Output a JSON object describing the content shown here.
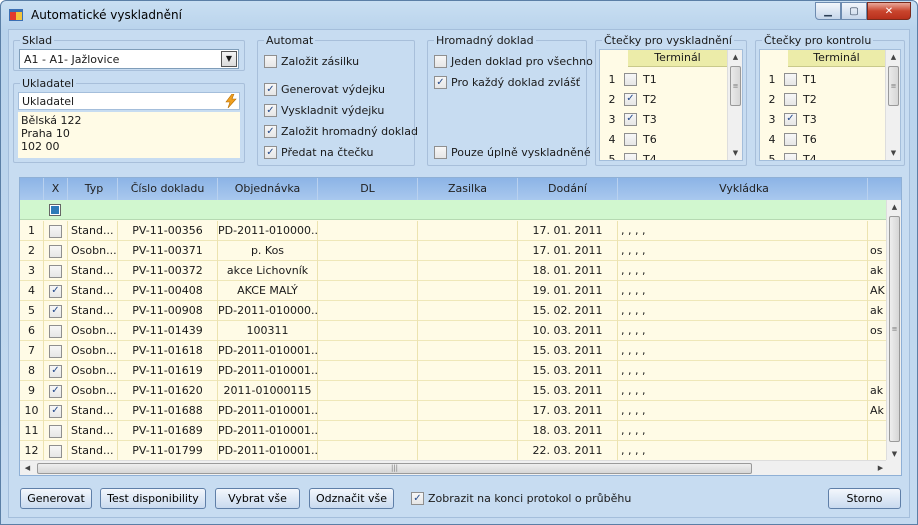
{
  "window": {
    "title": "Automatické vyskladnění",
    "min": "▁",
    "max": "▢",
    "close": "✕"
  },
  "sklad": {
    "label": "Sklad",
    "value": "A1 - A1- Jažlovice"
  },
  "ukladatel": {
    "label": "Ukladatel",
    "value": "Ukladatel",
    "address": [
      "Bělská 122",
      "Praha 10",
      "102 00"
    ]
  },
  "automat": {
    "label": "Automat",
    "items": [
      {
        "label": "Založit zásilku",
        "checked": false
      },
      {
        "label": "Generovat výdejku",
        "checked": true
      },
      {
        "label": "Vyskladnit výdejku",
        "checked": true
      },
      {
        "label": "Založit hromadný doklad",
        "checked": true
      },
      {
        "label": "Předat na čtečku",
        "checked": true
      }
    ]
  },
  "hromadny": {
    "label": "Hromadný doklad",
    "items": [
      {
        "label": "Jeden doklad pro všechno",
        "checked": false
      },
      {
        "label": "Pro každý doklad zvlášť",
        "checked": true
      },
      {
        "label": "Pouze úplně vyskladněné",
        "checked": false
      }
    ]
  },
  "ctecky_vysk": {
    "label": "Čtečky pro vyskladnění",
    "header": "Terminál",
    "rows": [
      {
        "n": "1",
        "t": "T1",
        "checked": false
      },
      {
        "n": "2",
        "t": "T2",
        "checked": true
      },
      {
        "n": "3",
        "t": "T3",
        "checked": true
      },
      {
        "n": "4",
        "t": "T6",
        "checked": false
      },
      {
        "n": "5",
        "t": "T4",
        "checked": false
      }
    ]
  },
  "ctecky_kontrola": {
    "label": "Čtečky pro kontrolu",
    "header": "Terminál",
    "rows": [
      {
        "n": "1",
        "t": "T1",
        "checked": false
      },
      {
        "n": "2",
        "t": "T2",
        "checked": false
      },
      {
        "n": "3",
        "t": "T3",
        "checked": true
      },
      {
        "n": "4",
        "t": "T6",
        "checked": false
      },
      {
        "n": "5",
        "t": "T4",
        "checked": false
      }
    ]
  },
  "grid": {
    "columns": [
      "",
      "X",
      "Typ",
      "Číslo dokladu",
      "Objednávka",
      "DL",
      "Zasilka",
      "Dodání",
      "Vykládka",
      ""
    ],
    "rows": [
      {
        "n": "1",
        "x": false,
        "typ": "Stand...",
        "cislo": "PV-11-00356",
        "obj": "PD-2011-010000...",
        "dl": "",
        "zas": "",
        "dod": "17. 01. 2011",
        "vyk": ", , , ,",
        "extra": ""
      },
      {
        "n": "2",
        "x": false,
        "typ": "Osobn...",
        "cislo": "PV-11-00371",
        "obj": "p. Kos",
        "dl": "",
        "zas": "",
        "dod": "17. 01. 2011",
        "vyk": ", , , ,",
        "extra": "os"
      },
      {
        "n": "3",
        "x": false,
        "typ": "Stand...",
        "cislo": "PV-11-00372",
        "obj": "akce Lichovník",
        "dl": "",
        "zas": "",
        "dod": "18. 01. 2011",
        "vyk": ", , , ,",
        "extra": "ak"
      },
      {
        "n": "4",
        "x": true,
        "typ": "Stand...",
        "cislo": "PV-11-00408",
        "obj": "AKCE MALÝ",
        "dl": "",
        "zas": "",
        "dod": "19. 01. 2011",
        "vyk": ", , , ,",
        "extra": "AK"
      },
      {
        "n": "5",
        "x": true,
        "typ": "Stand...",
        "cislo": "PV-11-00908",
        "obj": "PD-2011-010000...",
        "dl": "",
        "zas": "",
        "dod": "15. 02. 2011",
        "vyk": ", , , ,",
        "extra": "ak"
      },
      {
        "n": "6",
        "x": false,
        "typ": "Osobn...",
        "cislo": "PV-11-01439",
        "obj": "100311",
        "dl": "",
        "zas": "",
        "dod": "10. 03. 2011",
        "vyk": ", , , ,",
        "extra": "os"
      },
      {
        "n": "7",
        "x": false,
        "typ": "Osobn...",
        "cislo": "PV-11-01618",
        "obj": "PD-2011-010001...",
        "dl": "",
        "zas": "",
        "dod": "15. 03. 2011",
        "vyk": ", , , ,",
        "extra": ""
      },
      {
        "n": "8",
        "x": true,
        "typ": "Osobn...",
        "cislo": "PV-11-01619",
        "obj": "PD-2011-010001...",
        "dl": "",
        "zas": "",
        "dod": "15. 03. 2011",
        "vyk": ", , , ,",
        "extra": ""
      },
      {
        "n": "9",
        "x": true,
        "typ": "Osobn...",
        "cislo": "PV-11-01620",
        "obj": "2011-01000115",
        "dl": "",
        "zas": "",
        "dod": "15. 03. 2011",
        "vyk": ", , , ,",
        "extra": "ak"
      },
      {
        "n": "10",
        "x": true,
        "typ": "Stand...",
        "cislo": "PV-11-01688",
        "obj": "PD-2011-010001...",
        "dl": "",
        "zas": "",
        "dod": "17. 03. 2011",
        "vyk": ", , , ,",
        "extra": "Ak"
      },
      {
        "n": "11",
        "x": false,
        "typ": "Stand...",
        "cislo": "PV-11-01689",
        "obj": "PD-2011-010001...",
        "dl": "",
        "zas": "",
        "dod": "18. 03. 2011",
        "vyk": ", , , ,",
        "extra": ""
      },
      {
        "n": "12",
        "x": false,
        "typ": "Stand...",
        "cislo": "PV-11-01799",
        "obj": "PD-2011-010001...",
        "dl": "",
        "zas": "",
        "dod": "22. 03. 2011",
        "vyk": ", , , ,",
        "extra": ""
      }
    ]
  },
  "buttons": {
    "generovat": "Generovat",
    "test": "Test disponibility",
    "vybrat": "Vybrat vše",
    "odznacit": "Odznačit vše",
    "storno": "Storno"
  },
  "protokol": {
    "label": "Zobrazit na konci protokol o průběhu",
    "checked": true
  },
  "colors": {
    "grid_header": "#a9c8ee",
    "filter_row": "#d1f7cf",
    "grid_bg": "#fffbe6",
    "terminal_header": "#ececa9"
  }
}
